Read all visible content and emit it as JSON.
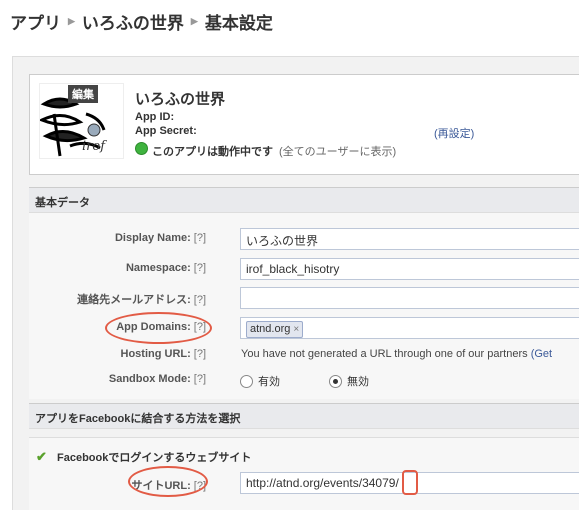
{
  "breadcrumb": {
    "items": [
      "アプリ",
      "いろふの世界",
      "基本設定"
    ]
  },
  "app": {
    "edit_label": "編集",
    "name": "いろふの世界",
    "app_id_label": "App ID:",
    "app_secret_label": "App Secret:",
    "reset_label": "(再設定)",
    "status_text": "このアプリは動作中です",
    "status_note": "(全てのユーザーに表示)",
    "status_color": "#3fb33f"
  },
  "basic_data": {
    "title": "基本データ",
    "display_name": {
      "label": "Display Name:",
      "help": "[?]",
      "value": "いろふの世界"
    },
    "namespace": {
      "label": "Namespace:",
      "help": "[?]",
      "value": "irof_black_hisotry"
    },
    "contact_email": {
      "label": "連絡先メールアドレス:",
      "help": "[?]",
      "value": ""
    },
    "app_domains": {
      "label": "App Domains:",
      "help": "[?]",
      "token": "atnd.org",
      "remove": "×"
    },
    "hosting_url": {
      "label": "Hosting URL:",
      "help": "[?]",
      "text": "You have not generated a URL through one of our partners",
      "link": "(Get"
    },
    "sandbox_mode": {
      "label": "Sandbox Mode:",
      "help": "[?]",
      "options": [
        "有効",
        "無効"
      ],
      "selected": "無効"
    }
  },
  "integration": {
    "title": "アプリをFacebookに結合する方法を選択",
    "check_icon": "checkmark-icon",
    "website_title": "Facebookでログインするウェブサイト",
    "site_url": {
      "label": "サイトURL:",
      "help": "[?]",
      "value": "http://atnd.org/events/34079/"
    }
  },
  "annotation_color": "#e25b45"
}
